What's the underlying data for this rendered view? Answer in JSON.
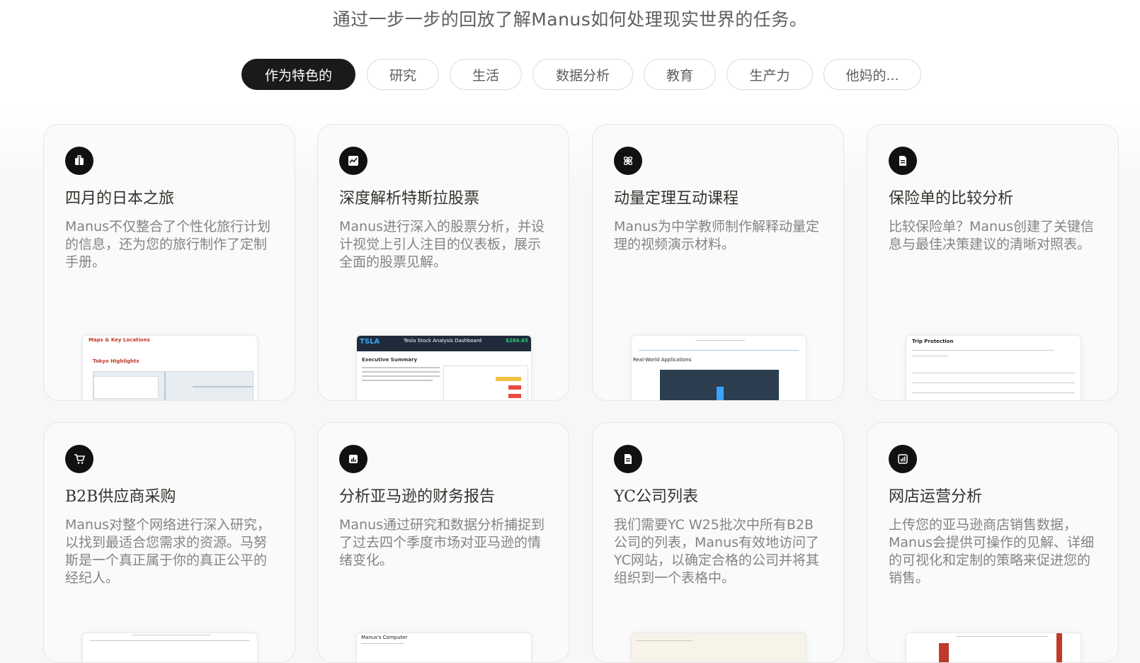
{
  "subtitle": "通过一步一步的回放了解Manus如何处理现实世界的任务。",
  "tabs": [
    {
      "label": "作为特色的",
      "active": true
    },
    {
      "label": "研究",
      "active": false
    },
    {
      "label": "生活",
      "active": false
    },
    {
      "label": "数据分析",
      "active": false
    },
    {
      "label": "教育",
      "active": false
    },
    {
      "label": "生产力",
      "active": false
    },
    {
      "label": "他妈的...",
      "active": false
    }
  ],
  "cards": [
    {
      "icon": "luggage-icon",
      "title": "四月的日本之旅",
      "desc": "Manus不仅整合了个性化旅行计划的信息，还为您的旅行制作了定制手册。",
      "thumb": {
        "heading": "Maps & Key Locations",
        "sub": "Tokyo Highlights"
      }
    },
    {
      "icon": "chart-icon",
      "title": "深度解析特斯拉股票",
      "desc": "Manus进行深入的股票分析，并设计视觉上引人注目的仪表板，展示全面的股票见解。",
      "thumb": {
        "ticker": "TSLA",
        "heading": "Tesla Stock Analysis Dashboard",
        "price": "$284.65",
        "sub": "Executive Summary"
      }
    },
    {
      "icon": "atom-icon",
      "title": "动量定理互动课程",
      "desc": "Manus为中学教师制作解释动量定理的视频演示材料。",
      "thumb": {
        "heading": "Real-World Applications"
      }
    },
    {
      "icon": "document-icon",
      "title": "保险单的比较分析",
      "desc": "比较保险单？Manus创建了关键信息与最佳决策建议的清晰对照表。",
      "thumb": {
        "heading": "Trip Protection"
      }
    },
    {
      "icon": "cart-icon",
      "title": "B2B供应商采购",
      "desc": "Manus对整个网络进行深入研究，以找到最适合您需求的资源。马努斯是一个真正属于你的真正公平的经纪人。",
      "thumb": {}
    },
    {
      "icon": "report-icon",
      "title": "分析亚马逊的财务报告",
      "desc": "Manus通过研究和数据分析捕捉到了过去四个季度市场对亚马逊的情绪变化。",
      "thumb": {
        "heading": "Manus's Computer"
      }
    },
    {
      "icon": "document-icon",
      "title": "YC公司列表",
      "desc": "我们需要YC W25批次中所有B2B公司的列表，Manus有效地访问了YC网站，以确定合格的公司并将其组织到一个表格中。",
      "thumb": {}
    },
    {
      "icon": "analytics-icon",
      "title": "网店运营分析",
      "desc": "上传您的亚马逊商店销售数据，Manus会提供可操作的见解、详细的可视化和定制的策略来促进您的销售。",
      "thumb": {}
    }
  ]
}
